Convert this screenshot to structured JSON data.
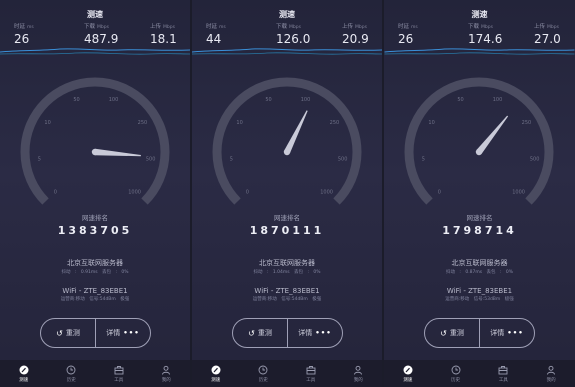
{
  "screens": [
    {
      "title": "测速",
      "ping": {
        "label": "时延",
        "unit": "ms",
        "value": "26"
      },
      "download": {
        "label": "下载",
        "unit": "Mbps",
        "value": "487.9"
      },
      "upload": {
        "label": "上传",
        "unit": "Mbps",
        "value": "18.1"
      },
      "rank_label": "网速排名",
      "rank": "1383705",
      "server": "北京互联网服务器",
      "server_sub": "抖动 : 0.91ms     丢包 : 0%",
      "wifi": "WiFi - ZTE_83EBE1",
      "wifi_sub": "运营商:移动     信号:54dBm 极强",
      "retest": "重测",
      "details": "详情",
      "needle_value": 487.9
    },
    {
      "title": "测速",
      "ping": {
        "label": "时延",
        "unit": "ms",
        "value": "44"
      },
      "download": {
        "label": "下载",
        "unit": "Mbps",
        "value": "126.0"
      },
      "upload": {
        "label": "上传",
        "unit": "Mbps",
        "value": "20.9"
      },
      "rank_label": "网速排名",
      "rank": "1870111",
      "server": "北京互联网服务器",
      "server_sub": "抖动 : 1.04ms     丢包 : 0%",
      "wifi": "WiFi - ZTE_83EBE1",
      "wifi_sub": "运营商:移动     信号:54dBm 极强",
      "retest": "重测",
      "details": "详情",
      "needle_value": 126.0
    },
    {
      "title": "测速",
      "ping": {
        "label": "时延",
        "unit": "ms",
        "value": "26"
      },
      "download": {
        "label": "下载",
        "unit": "Mbps",
        "value": "174.6"
      },
      "upload": {
        "label": "上传",
        "unit": "Mbps",
        "value": "27.0"
      },
      "rank_label": "网速排名",
      "rank": "1798714",
      "server": "北京互联网服务器",
      "server_sub": "抖动 : 0.87ms     丢包 : 0%",
      "wifi": "WiFi - ZTE_83EBE1",
      "wifi_sub": "运营商:移动     信号:53dBm 极强",
      "retest": "重测",
      "details": "详情",
      "needle_value": 174.6
    }
  ],
  "gauge": {
    "ticks": [
      "0",
      "5",
      "10",
      "50",
      "100",
      "250",
      "500",
      "1000"
    ]
  },
  "tabs": [
    {
      "label": "测速",
      "icon": "speedometer-icon",
      "active": true
    },
    {
      "label": "历史",
      "icon": "clock-icon",
      "active": false
    },
    {
      "label": "工具",
      "icon": "toolbox-icon",
      "active": false
    },
    {
      "label": "我的",
      "icon": "user-icon",
      "active": false
    }
  ],
  "colors": {
    "background": "#23243a",
    "accent": "#3a8fd8",
    "gauge_track": "#4a4b60",
    "needle": "#c9cad8"
  }
}
